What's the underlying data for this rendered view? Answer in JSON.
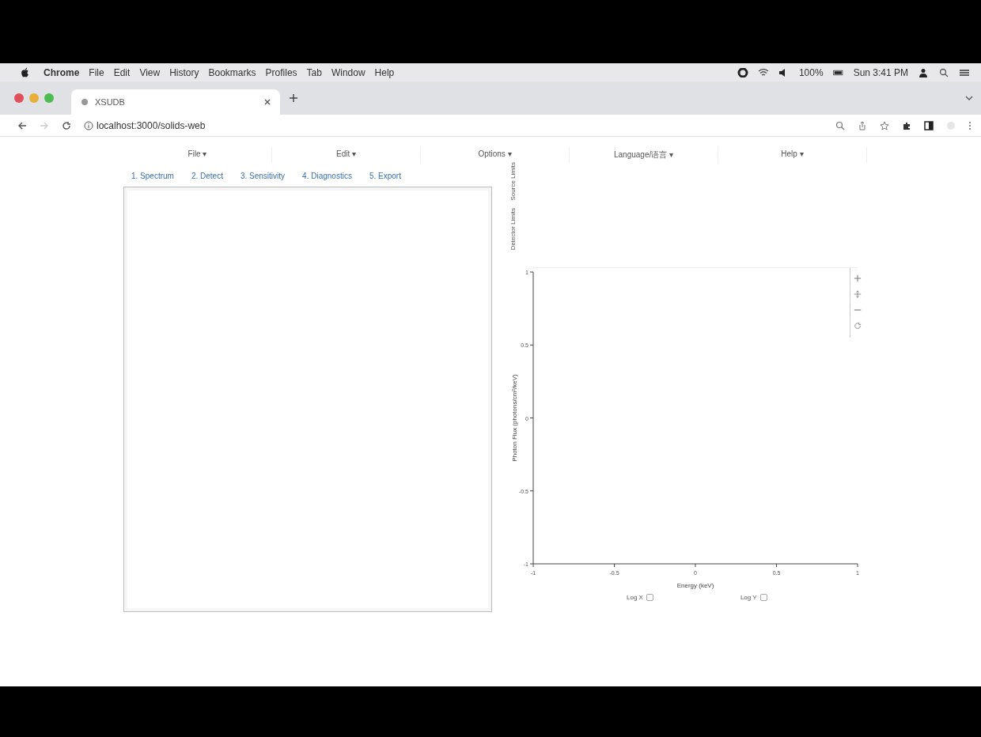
{
  "mac_menu_bar": {
    "items": [
      "Chrome",
      "File",
      "Edit",
      "View",
      "History",
      "Bookmarks",
      "Profiles",
      "Tab",
      "Window",
      "Help"
    ],
    "battery": "100%",
    "clock": "Sun 3:41 PM"
  },
  "browser": {
    "tab_title": "XSUDB",
    "url": "localhost:3000/solids-web"
  },
  "app_menu": [
    "File ▾",
    "Edit ▾",
    "Options ▾",
    "Language/语言 ▾",
    "Help ▾"
  ],
  "step_tabs": [
    "1. Spectrum",
    "2. Detect",
    "3. Sensitivity",
    "4. Diagnostics",
    "5. Export"
  ],
  "side_tabs": [
    "Detector Limits",
    "Source Limits"
  ],
  "chart": {
    "chart_data": {
      "type": "line",
      "xlabel": "Energy (keV)",
      "ylabel": "Photon Flux (photons/cm²/keV)",
      "xlim": [
        -1,
        1
      ],
      "ylim": [
        -1,
        1
      ],
      "xticks": [
        -1,
        -0.5,
        0,
        0.5,
        1
      ],
      "yticks": [
        -1,
        -0.5,
        0,
        0.5,
        1
      ]
    }
  },
  "log_options": [
    {
      "label": "Log X",
      "checked": false
    },
    {
      "label": "Log Y",
      "checked": false
    }
  ]
}
